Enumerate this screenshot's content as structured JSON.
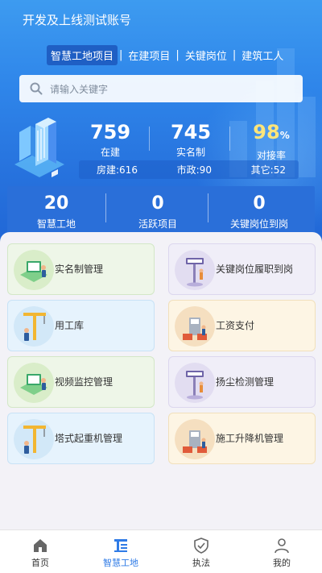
{
  "header": {
    "title": "开发及上线测试账号"
  },
  "tabs": [
    {
      "label": "智慧工地项目",
      "active": true
    },
    {
      "label": "在建项目",
      "active": false
    },
    {
      "label": "关键岗位",
      "active": false
    },
    {
      "label": "建筑工人",
      "active": false
    }
  ],
  "tab_separator": "|",
  "search": {
    "placeholder": "请输入关键字"
  },
  "stats": [
    {
      "value": "759",
      "label": "在建"
    },
    {
      "value": "745",
      "label": "实名制"
    },
    {
      "value": "98",
      "unit": "%",
      "label": "对接率"
    }
  ],
  "breakdown": [
    "房建:616",
    "市政:90",
    "其它:52"
  ],
  "summary": [
    {
      "value": "20",
      "label": "智慧工地"
    },
    {
      "value": "0",
      "label": "活跃项目"
    },
    {
      "value": "0",
      "label": "关键岗位到岗"
    }
  ],
  "modules": [
    {
      "label": "实名制管理",
      "icon": "worker-tablet-icon",
      "color": "green"
    },
    {
      "label": "关键岗位履职到岗",
      "icon": "signpost-person-icon",
      "color": "purple"
    },
    {
      "label": "用工库",
      "icon": "crane-worker-icon",
      "color": "blue"
    },
    {
      "label": "工资支付",
      "icon": "machine-worker-icon",
      "color": "orange"
    },
    {
      "label": "视频监控管理",
      "icon": "worker-tablet-icon",
      "color": "green"
    },
    {
      "label": "扬尘检测管理",
      "icon": "signpost-person-icon",
      "color": "purple"
    },
    {
      "label": "塔式起重机管理",
      "icon": "crane-worker-icon",
      "color": "blue"
    },
    {
      "label": "施工升降机管理",
      "icon": "machine-worker-icon",
      "color": "orange"
    }
  ],
  "bottom_nav": [
    {
      "label": "首页",
      "icon": "home-icon",
      "active": false
    },
    {
      "label": "智慧工地",
      "icon": "site-icon",
      "active": true
    },
    {
      "label": "执法",
      "icon": "shield-check-icon",
      "active": false
    },
    {
      "label": "我的",
      "icon": "user-icon",
      "active": false
    }
  ],
  "colors": {
    "accent": "#2f7be6",
    "rate_highlight": "#ffe57a",
    "hero": "#2f86ea"
  }
}
